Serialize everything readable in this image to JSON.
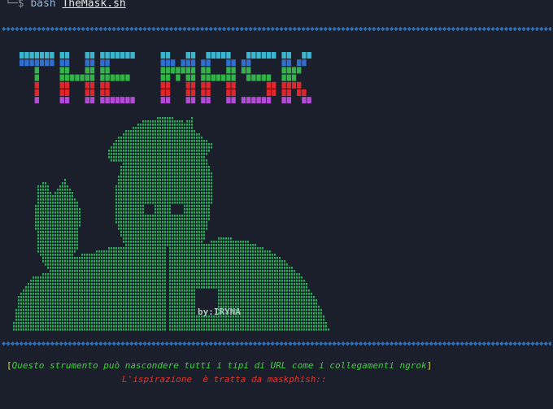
{
  "terminal": {
    "prompt_prefix": "└─$ ",
    "command": "bash ",
    "script_name": "TheMask.sh"
  },
  "banner": {
    "divider_char": "◆",
    "logo_text": "THE MASK",
    "credit": "by:IRYNA",
    "colors": {
      "cyan": "#3ab7cf",
      "blue": "#2f6fd0",
      "green": "#34b24a",
      "red": "#e0262a",
      "magenta": "#b24ad4",
      "figure": "#2faa60",
      "divider": "#2f6fb6"
    }
  },
  "info": {
    "open_bracket": "[",
    "description": "Questo strumento può nascondere tutti i tipi di URL come i collegamenti ngrok",
    "close_bracket": "]",
    "inspiration": "L'ispirazione  è tratta da maskphish::"
  }
}
